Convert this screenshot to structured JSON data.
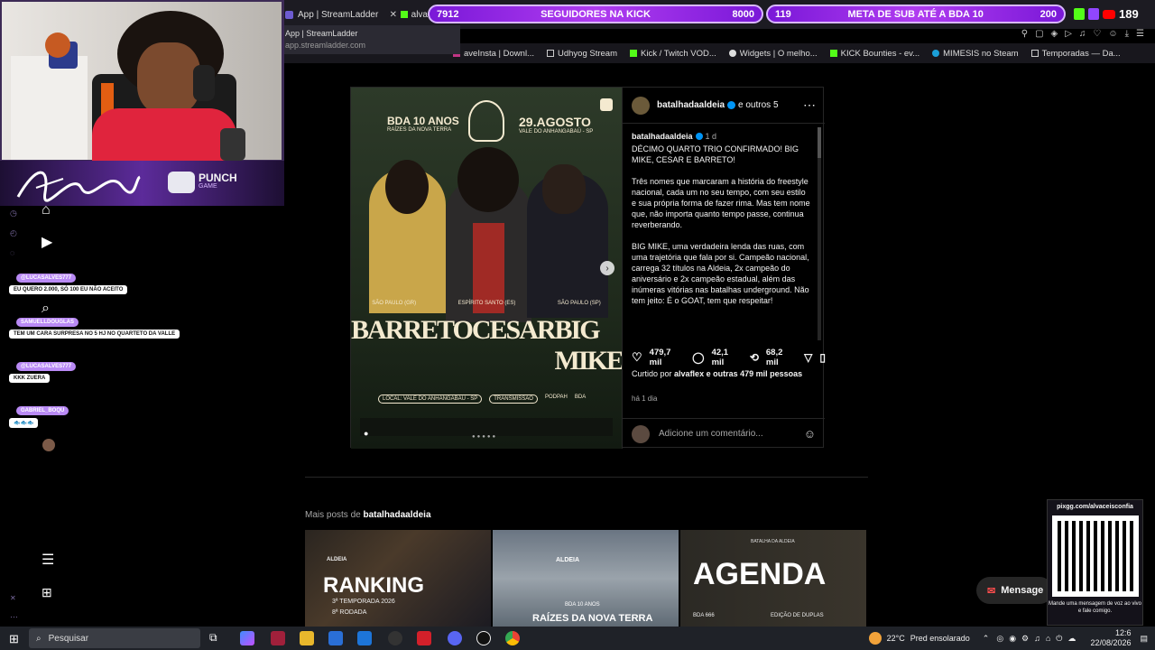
{
  "browser": {
    "tabs": [
      {
        "label": "App | StreamLadder"
      },
      {
        "label": "alva"
      }
    ],
    "tooltip": {
      "title": "App | StreamLadder",
      "url": "app.streamladder.com"
    },
    "bookmarks": [
      "aveInsta | Downl...",
      "Udhyog Stream",
      "Kick / Twitch VOD...",
      "Widgets | O melho...",
      "KICK Bounties - ev...",
      "MIMESIS no Steam",
      "Temporadas — Da..."
    ]
  },
  "overlay": {
    "followers_bar": {
      "current": "7912",
      "label": "SEGUIDORES NA KICK",
      "goal": "8000"
    },
    "sub_bar": {
      "current": "119",
      "label": "META DE SUB ATÉ A BDA 10",
      "goal": "200"
    },
    "viewer_count": "189",
    "webcam_brand": "PUNCH",
    "webcam_brand_sub": "GAME",
    "chat": [
      {
        "user": "@LUCASALVES777",
        "text": "EU QUERO 2.000, SÓ 100 EU NÃO ACEITO"
      },
      {
        "user": "SAMUELLDOUGLAS",
        "text": "TEM UM CARA SURPRESA NO 5 HJ NO QUARTETO DA VALLE"
      },
      {
        "user": "@LUCASALVES777",
        "text": "KKK ZUERA"
      },
      {
        "user": "GABRIEL_BOQU",
        "text": "🐟🐟🐟"
      }
    ],
    "qr": {
      "url": "pixgg.com/alvaceisconfia",
      "caption": "Mande uma mensagem de voz ao vivo e fale comigo."
    },
    "message_button": "Mensage"
  },
  "post": {
    "header_user": "batalhadaaldeia",
    "header_others": "e outros 5",
    "image": {
      "event_left": "BDA 10 ANOS",
      "event_left_sub": "RAÍZES DA NOVA TERRA",
      "event_date": "29.AGOSTO",
      "event_place": "VALE DO ANHANGABAÚ - SP",
      "names": [
        "BARRETO",
        "CESAR",
        "BIG MIKE"
      ],
      "origins": [
        "SÃO PAULO (GR)",
        "ESPÍRITO SANTO (ES)",
        "SÃO PAULO (SP)"
      ],
      "local": "LOCAL: VALE DO ANHANGABAÚ - SP",
      "transmission": "TRANSMISSÃO",
      "podpah": "PODPAH",
      "bda": "BDA"
    },
    "caption_user": "batalhadaaldeia",
    "caption_age": "1 d",
    "caption_paragraphs": [
      "DÉCIMO QUARTO TRIO CONFIRMADO! BIG MIKE, CESAR E BARRETO!",
      "Três nomes que marcaram a história do freestyle nacional, cada um no seu tempo, com seu estilo e sua própria forma de fazer rima. Mas tem nome que, não importa quanto tempo passe, continua reverberando.",
      "BIG MIKE, uma verdadeira lenda das ruas, com uma trajetória que fala por si. Campeão nacional, carrega 32 títulos na Aldeia, 2x campeão do aniversário e 2x campeão estadual, além das inúmeras vitórias nas batalhas underground. Não tem jeito: É o GOAT, tem que respeitar!"
    ],
    "likes": "479,7 mil",
    "comments": "42,1 mil",
    "reposts": "68,2 mil",
    "liked_by_prefix": "Curtido por",
    "liked_by_user": "alvaflex",
    "liked_by_suffix": "e outras 479 mil pessoas",
    "time_ago": "há 1 dia",
    "comment_placeholder": "Adicione um comentário..."
  },
  "more_posts": {
    "title_prefix": "Mais posts de",
    "title_user": "batalhadaaldeia",
    "thumbs": [
      {
        "brand": "ALDEIA",
        "heading": "RANKING",
        "line1": "3ª TEMPORADA 2026",
        "line2": "8ª RODADA"
      },
      {
        "brand": "ALDEIA",
        "heading": "RAÍZES DA NOVA TERRA",
        "line1": "BDA 10 ANOS"
      },
      {
        "brand": "BATALHA DA ALDEIA",
        "heading": "AGENDA",
        "line1": "BDA 666",
        "line2": "EDIÇÃO DE DUPLAS"
      }
    ]
  },
  "taskbar": {
    "search_placeholder": "Pesquisar",
    "weather_temp": "22°C",
    "weather_text": "Pred ensolarado",
    "time": "12:6",
    "date": "22/08/2026"
  }
}
